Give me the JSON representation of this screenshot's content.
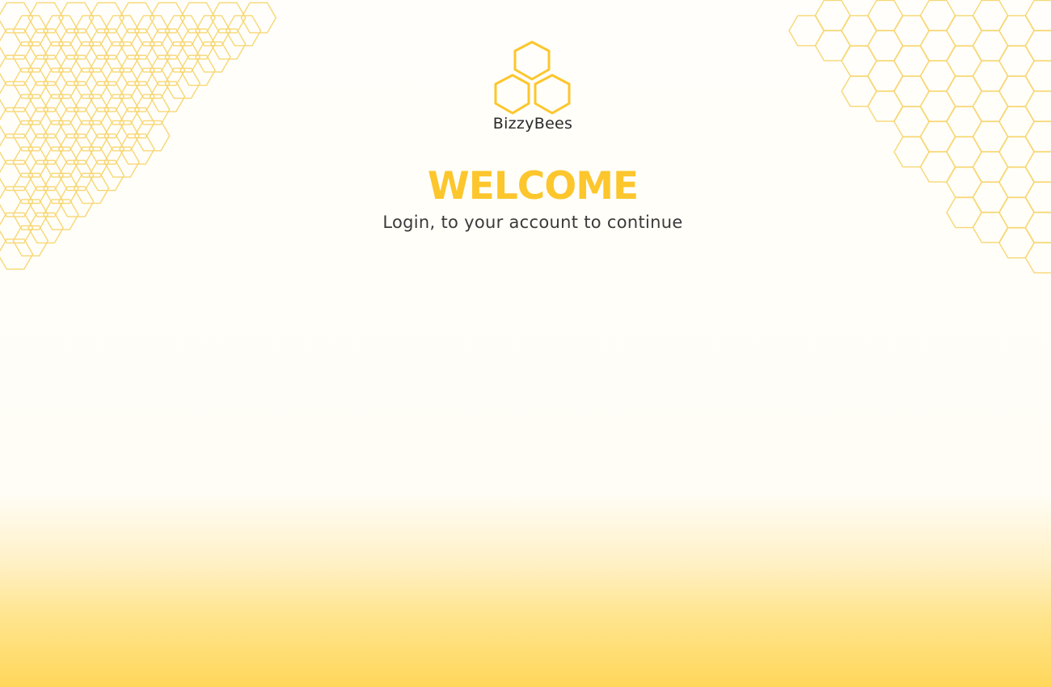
{
  "brand": {
    "name": "BizzyBees",
    "accent_color": "#fcc62c"
  },
  "hero": {
    "title": "WELCOME",
    "subtitle": "Login, to your account to continue"
  },
  "decor": {
    "pattern": "honeycomb",
    "stroke_color": "#f7d774"
  }
}
